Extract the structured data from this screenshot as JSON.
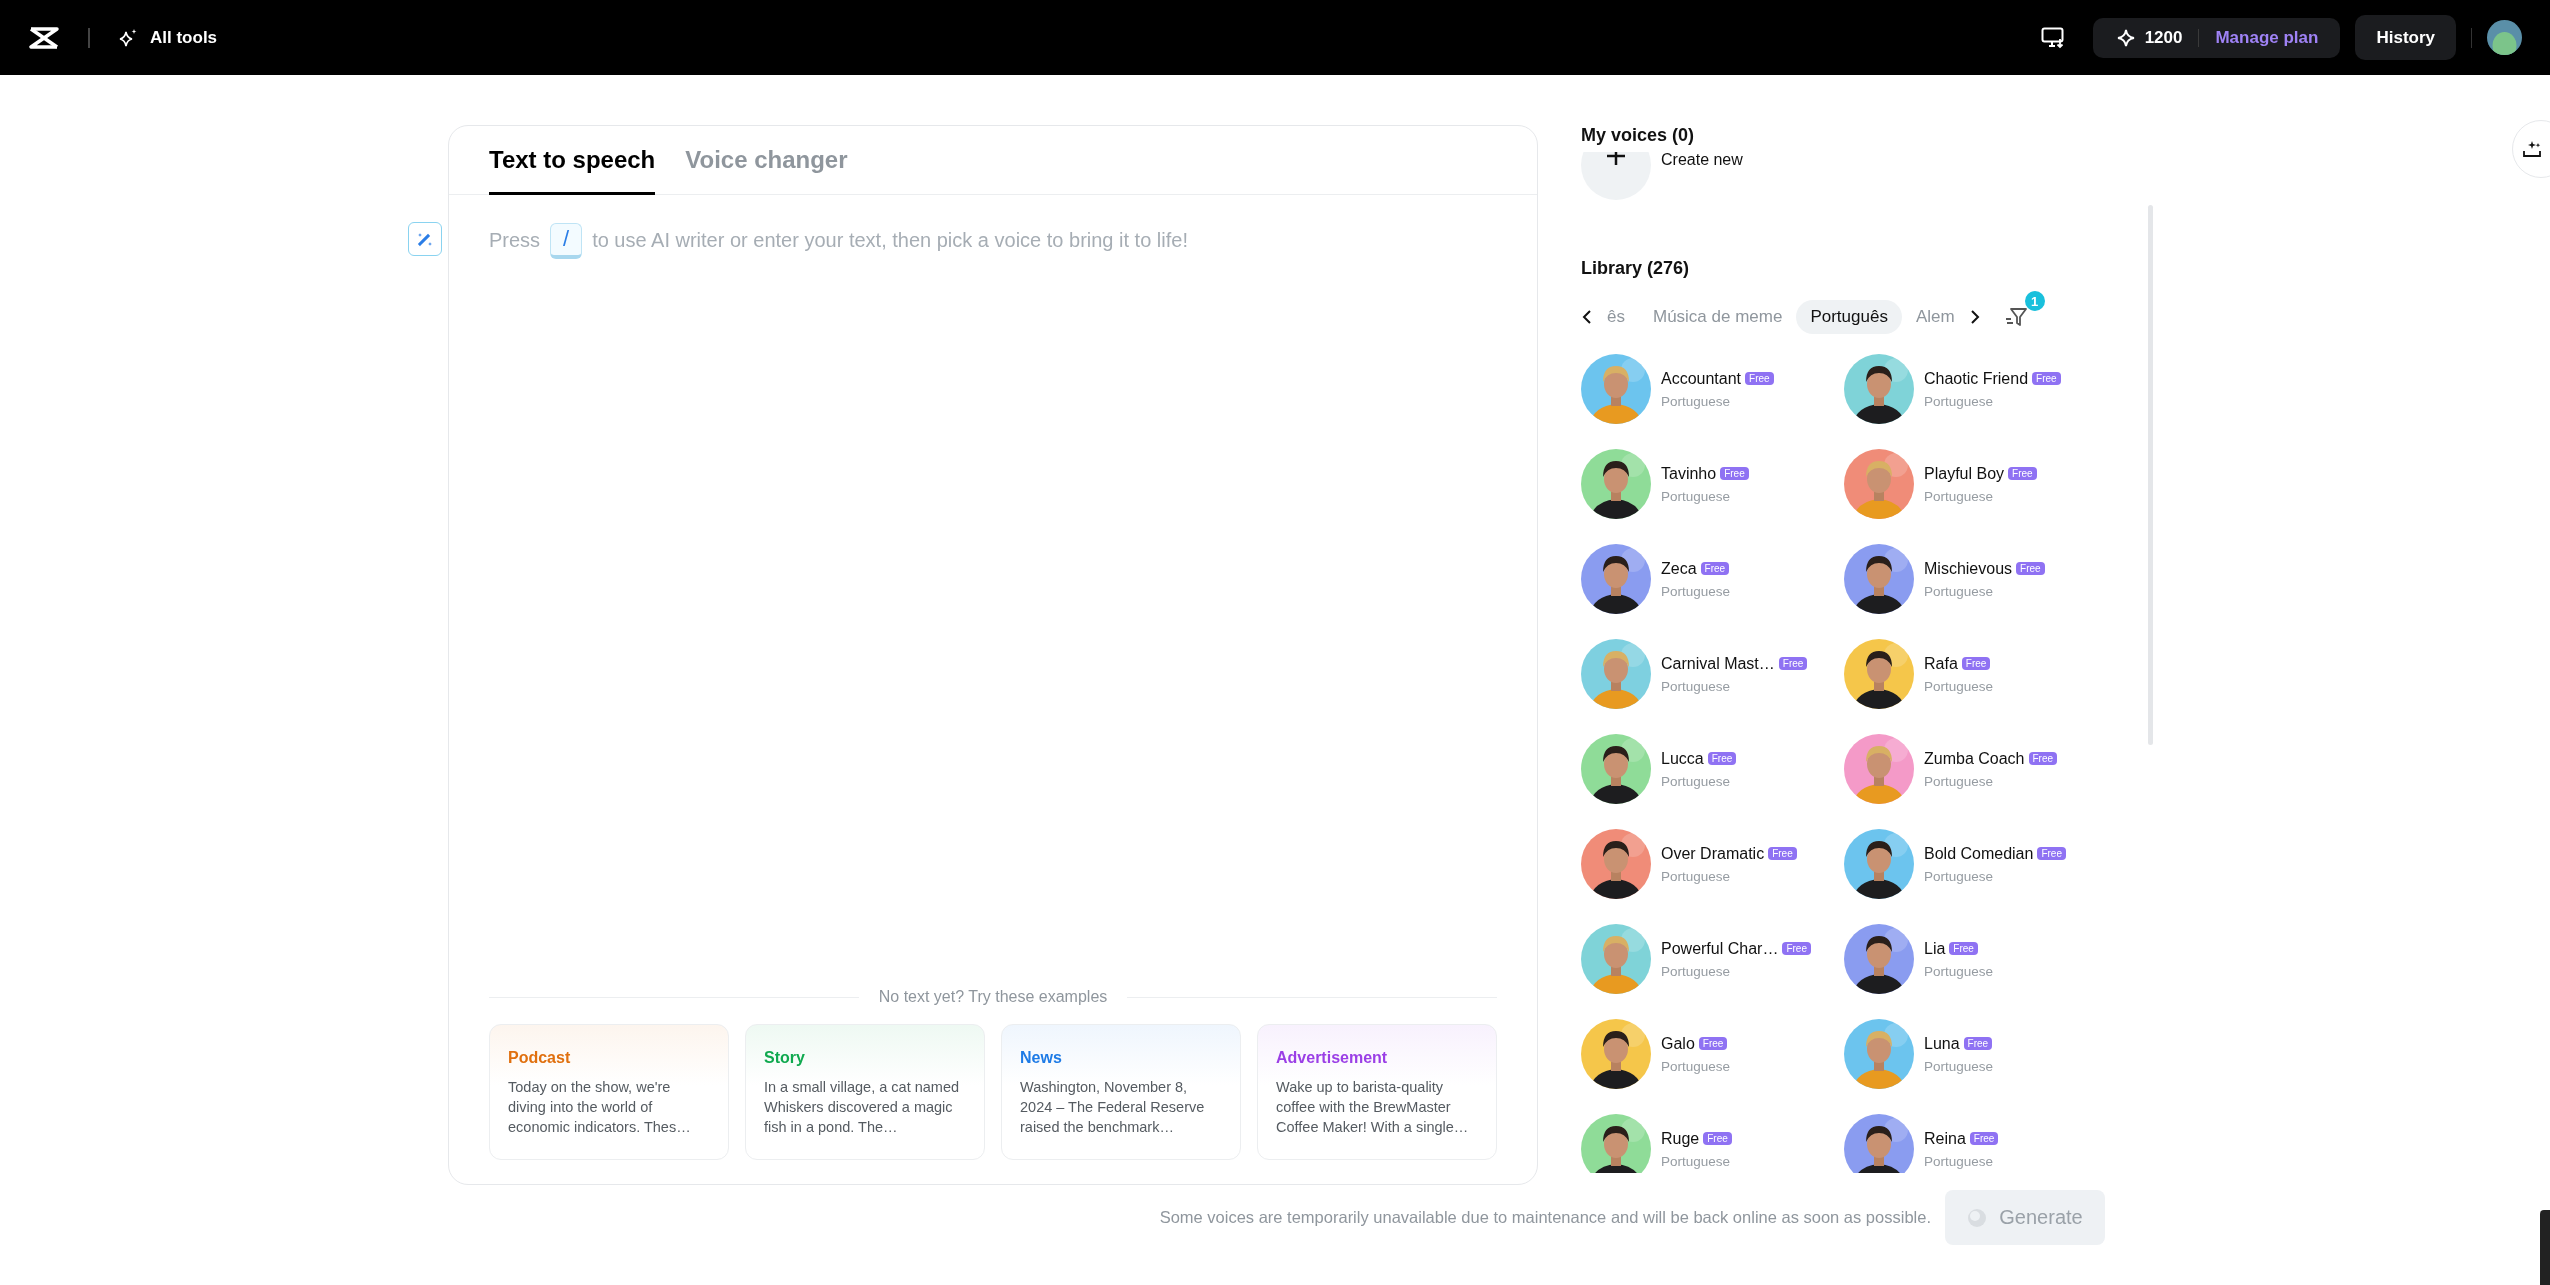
{
  "topbar": {
    "tools_label": "All tools",
    "credits": "1200",
    "plan_link": "Manage plan",
    "history_button": "History"
  },
  "editor": {
    "tabs": [
      {
        "label": "Text to speech",
        "selected": true
      },
      {
        "label": "Voice changer",
        "selected": false
      }
    ],
    "placeholder_before": "Press",
    "shortcut_key": "/",
    "placeholder_after": "to use AI writer or enter your text, then pick a voice to bring it to life!",
    "examples_heading": "No text yet? Try these examples",
    "examples": [
      {
        "title": "Podcast",
        "color": "#e0700f",
        "text": "Today on the show, we're diving into the world of economic indicators. Thes…"
      },
      {
        "title": "Story",
        "color": "#10a94f",
        "text": "In a small village, a cat named Whiskers discovered a magic fish in a pond. The…"
      },
      {
        "title": "News",
        "color": "#1e7be6",
        "text": "Washington, November 8, 2024 – The Federal Reserve raised the benchmark…"
      },
      {
        "title": "Advertisement",
        "color": "#9b3fe6",
        "text": "Wake up to barista-quality coffee with the BrewMaster Coffee Maker! With a single…"
      }
    ]
  },
  "voices": {
    "my_voices_title": "My voices (0)",
    "create_label": "Create new",
    "library_title": "Library (276)",
    "filters": [
      {
        "label": "ês",
        "selected": false
      },
      {
        "label": "Música de meme",
        "selected": false
      },
      {
        "label": "Português",
        "selected": true
      },
      {
        "label": "Alem",
        "selected": false
      }
    ],
    "filter_count": "1",
    "items": [
      {
        "name": "Accountant",
        "badge": "Free",
        "language": "Portuguese"
      },
      {
        "name": "Chaotic Friend",
        "badge": "Free",
        "language": "Portuguese"
      },
      {
        "name": "Tavinho",
        "badge": "Free",
        "language": "Portuguese"
      },
      {
        "name": "Playful Boy",
        "badge": "Free",
        "language": "Portuguese"
      },
      {
        "name": "Zeca",
        "badge": "Free",
        "language": "Portuguese"
      },
      {
        "name": "Mischievous",
        "badge": "Free",
        "language": "Portuguese"
      },
      {
        "name": "Carnival Mast…",
        "badge": "Free",
        "language": "Portuguese"
      },
      {
        "name": "Rafa",
        "badge": "Free",
        "language": "Portuguese"
      },
      {
        "name": "Lucca",
        "badge": "Free",
        "language": "Portuguese"
      },
      {
        "name": "Zumba Coach",
        "badge": "Free",
        "language": "Portuguese"
      },
      {
        "name": "Over Dramatic",
        "badge": "Free",
        "language": "Portuguese"
      },
      {
        "name": "Bold Comedian",
        "badge": "Free",
        "language": "Portuguese"
      },
      {
        "name": "Powerful Char…",
        "badge": "Free",
        "language": "Portuguese"
      },
      {
        "name": "Lia",
        "badge": "Free",
        "language": "Portuguese"
      },
      {
        "name": "Galo",
        "badge": "Free",
        "language": "Portuguese"
      },
      {
        "name": "Luna",
        "badge": "Free",
        "language": "Portuguese"
      },
      {
        "name": "Ruge",
        "badge": "Free",
        "language": "Portuguese"
      },
      {
        "name": "Reina",
        "badge": "Free",
        "language": "Portuguese"
      }
    ]
  },
  "notice": "Some voices are temporarily unavailable due to maintenance and will be back online as soon as possible.",
  "generate_button": {
    "label": "Generate",
    "disabled": true
  }
}
